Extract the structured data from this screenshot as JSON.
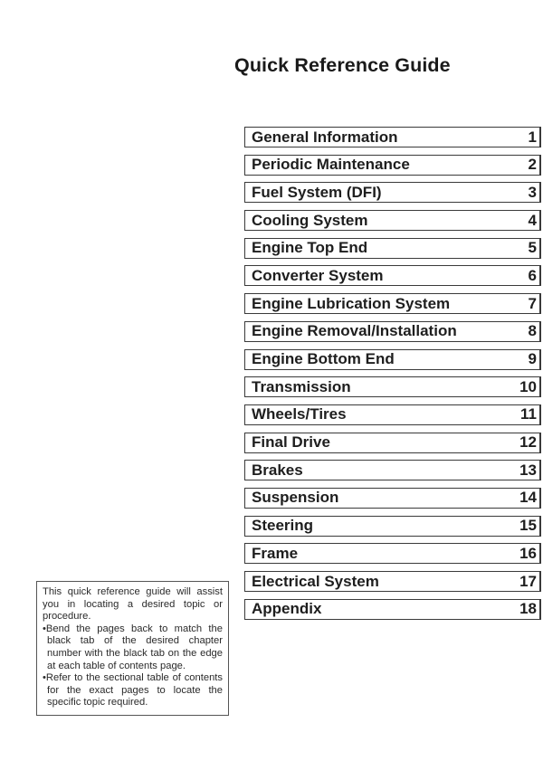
{
  "page": {
    "title": "Quick Reference Guide"
  },
  "toc": [
    {
      "label": "General Information",
      "number": "1"
    },
    {
      "label": "Periodic Maintenance",
      "number": "2"
    },
    {
      "label": "Fuel System (DFI)",
      "number": "3"
    },
    {
      "label": "Cooling System",
      "number": "4"
    },
    {
      "label": "Engine Top End",
      "number": "5"
    },
    {
      "label": "Converter System",
      "number": "6"
    },
    {
      "label": "Engine Lubrication System",
      "number": "7"
    },
    {
      "label": "Engine Removal/Installation",
      "number": "8"
    },
    {
      "label": "Engine Bottom End",
      "number": "9"
    },
    {
      "label": "Transmission",
      "number": "10"
    },
    {
      "label": "Wheels/Tires",
      "number": "11"
    },
    {
      "label": "Final Drive",
      "number": "12"
    },
    {
      "label": "Brakes",
      "number": "13"
    },
    {
      "label": "Suspension",
      "number": "14"
    },
    {
      "label": "Steering",
      "number": "15"
    },
    {
      "label": "Frame",
      "number": "16"
    },
    {
      "label": "Electrical System",
      "number": "17"
    },
    {
      "label": "Appendix",
      "number": "18"
    }
  ],
  "note": {
    "intro": "This quick reference guide will assist you in locating a desired topic or procedure.",
    "bullets": [
      "•Bend the pages back to match the black tab of the desired chapter number with the black tab on the edge at each table of contents page.",
      "•Refer to the sectional table of contents for the exact pages to locate the specific topic required."
    ]
  }
}
